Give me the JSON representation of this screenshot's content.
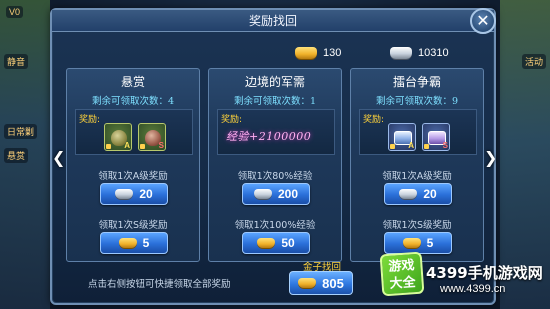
{
  "dialog": {
    "title": "奖励找回",
    "close_icon": "✕"
  },
  "currencies": {
    "gold_icon": "gold-ingot-icon",
    "gold_amount": "130",
    "silver_icon": "silver-ingot-icon",
    "silver_amount": "10310"
  },
  "cards": [
    {
      "title": "悬赏",
      "remaining": "剩余可领取次数：4",
      "reward_label": "奖励:",
      "items": [
        {
          "icon": "reward-bag-a-icon",
          "grade": "A"
        },
        {
          "icon": "reward-bag-s-icon",
          "grade": "S"
        }
      ],
      "option1_label": "领取1次A级奖励",
      "option1_cost": "20",
      "option1_currency": "silver",
      "option2_label": "领取1次S级奖励",
      "option2_cost": "5",
      "option2_currency": "gold"
    },
    {
      "title": "边境的军需",
      "remaining": "剩余可领取次数：1",
      "reward_label": "奖励:",
      "exp_reward": "经验+2100000",
      "option1_label": "领取1次80%经验",
      "option1_cost": "200",
      "option1_currency": "silver",
      "option2_label": "领取1次100%经验",
      "option2_cost": "50",
      "option2_currency": "gold"
    },
    {
      "title": "擂台争霸",
      "remaining": "剩余可领取次数：9",
      "reward_label": "奖励:",
      "items": [
        {
          "icon": "reward-chest-a-icon",
          "grade": "A"
        },
        {
          "icon": "reward-chest-s-icon",
          "grade": "S"
        }
      ],
      "option1_label": "领取1次A级奖励",
      "option1_cost": "20",
      "option1_currency": "silver",
      "option2_label": "领取1次S级奖励",
      "option2_cost": "5",
      "option2_currency": "gold"
    }
  ],
  "navigation": {
    "prev_icon": "❮",
    "next_icon": "❯"
  },
  "footer": {
    "hint": "点击右侧按钮可快捷领取全部奖励",
    "gold_recover_label": "金子找回",
    "gold_recover_cost": "805"
  },
  "background_hud": {
    "top_left_level": "V0",
    "left_menu_1": "静音",
    "left_quest_1": "日常剿",
    "left_quest_2": "悬赏",
    "right_text": "活动"
  },
  "watermark": {
    "badge_line1": "游戏",
    "badge_line2": "大全",
    "site_name": "4399手机游戏网",
    "site_url": "www.4399.cn"
  }
}
